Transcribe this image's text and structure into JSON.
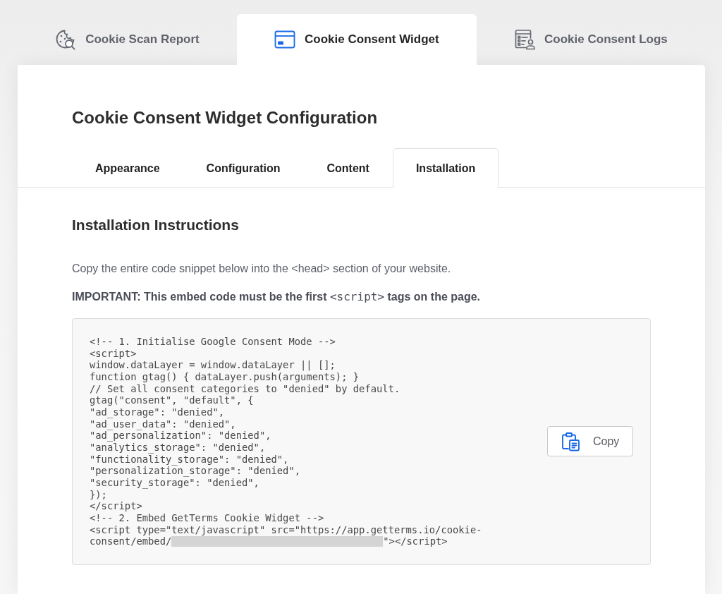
{
  "top_tabs": [
    {
      "kind": "scan",
      "label": "Cookie Scan Report",
      "selected": false
    },
    {
      "kind": "widget",
      "label": "Cookie Consent Widget",
      "selected": true
    },
    {
      "kind": "logs",
      "label": "Cookie Consent Logs",
      "selected": false
    }
  ],
  "page": {
    "title": "Cookie Consent Widget Configuration"
  },
  "sub_tabs": [
    {
      "label": "Appearance",
      "selected": false
    },
    {
      "label": "Configuration",
      "selected": false
    },
    {
      "label": "Content",
      "selected": false
    },
    {
      "label": "Installation",
      "selected": true
    }
  ],
  "section": {
    "heading": "Installation Instructions",
    "intro": "Copy the entire code snippet below into the <head> section of your website.",
    "important": {
      "text_before": "IMPORTANT: This embed code must be the first",
      "code": "<script>",
      "text_after": "tags on the page."
    }
  },
  "code_block": {
    "lines": [
      {
        "kind": "text",
        "text": "<!-- 1. Initialise Google Consent Mode -->"
      },
      {
        "kind": "text",
        "text": "<script>"
      },
      {
        "kind": "text",
        "text": "window.dataLayer = window.dataLayer || [];"
      },
      {
        "kind": "text",
        "text": "function gtag() { dataLayer.push(arguments); }"
      },
      {
        "kind": "text",
        "text": "// Set all consent categories to \"denied\" by default."
      },
      {
        "kind": "text",
        "text": "gtag(\"consent\", \"default\", {"
      },
      {
        "kind": "text",
        "text": "\"ad_storage\": \"denied\","
      },
      {
        "kind": "text",
        "text": "\"ad_user_data\": \"denied\","
      },
      {
        "kind": "text",
        "text": "\"ad_personalization\": \"denied\","
      },
      {
        "kind": "text",
        "text": "\"analytics_storage\": \"denied\","
      },
      {
        "kind": "text",
        "text": "\"functionality_storage\": \"denied\","
      },
      {
        "kind": "text",
        "text": "\"personalization_storage\": \"denied\","
      },
      {
        "kind": "text",
        "text": "\"security_storage\": \"denied\","
      },
      {
        "kind": "text",
        "text": "});"
      },
      {
        "kind": "text",
        "text": "</script>"
      },
      {
        "kind": "text",
        "text": "<!-- 2. Embed GetTerms Cookie Widget -->"
      },
      {
        "kind": "text",
        "text": "<script type=\"text/javascript\" src=\"https://app.getterms.io/cookie-"
      },
      {
        "kind": "redacted",
        "before": "consent/embed/",
        "after": "\"></script>"
      }
    ],
    "copy_button": {
      "label": "Copy"
    }
  }
}
